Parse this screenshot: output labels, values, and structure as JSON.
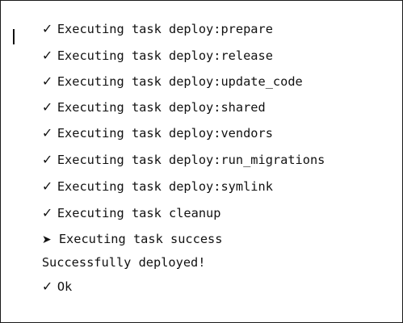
{
  "terminal": {
    "lines": [
      {
        "marker": "✓",
        "marker_icon": "check-icon",
        "text": "Executing task deploy:prepare"
      },
      {
        "marker": "✓",
        "marker_icon": "check-icon",
        "text": "Executing task deploy:release"
      },
      {
        "marker": "✓",
        "marker_icon": "check-icon",
        "text": "Executing task deploy:update_code"
      },
      {
        "marker": "✓",
        "marker_icon": "check-icon",
        "text": "Executing task deploy:shared"
      },
      {
        "marker": "✓",
        "marker_icon": "check-icon",
        "text": "Executing task deploy:vendors"
      },
      {
        "marker": "✓",
        "marker_icon": "check-icon",
        "text": "Executing task deploy:run_migrations"
      },
      {
        "marker": "✓",
        "marker_icon": "check-icon",
        "text": "Executing task deploy:symlink"
      },
      {
        "marker": "✓",
        "marker_icon": "check-icon",
        "text": "Executing task cleanup"
      },
      {
        "marker": "➤",
        "marker_icon": "arrow-right-icon",
        "text": "Executing task success"
      },
      {
        "marker": "",
        "marker_icon": "",
        "text": "Successfully deployed!"
      },
      {
        "marker": "✓",
        "marker_icon": "check-icon",
        "text": "Ok"
      }
    ]
  }
}
